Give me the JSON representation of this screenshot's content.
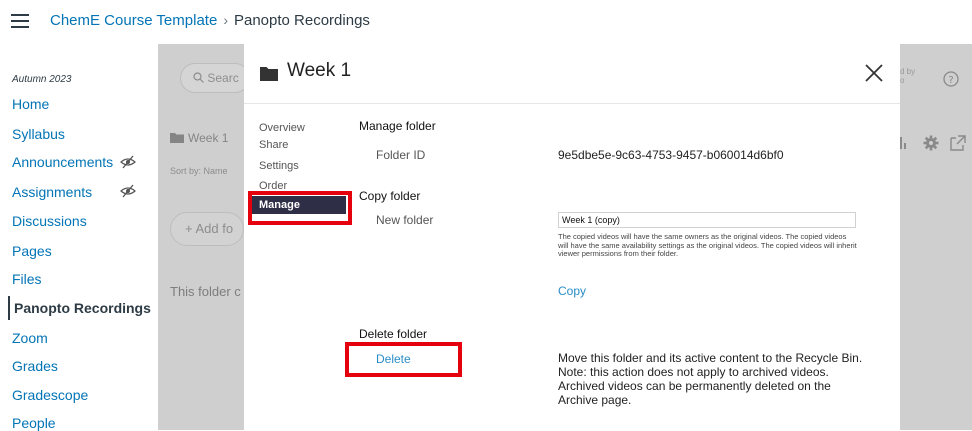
{
  "topbar": {
    "course_name": "ChemE Course Template",
    "separator": "›",
    "current_page": "Panopto Recordings"
  },
  "sidebar": {
    "term": "Autumn 2023",
    "items": [
      {
        "label": "Home"
      },
      {
        "label": "Syllabus"
      },
      {
        "label": "Announcements"
      },
      {
        "label": "Assignments"
      },
      {
        "label": "Discussions"
      },
      {
        "label": "Pages"
      },
      {
        "label": "Files"
      },
      {
        "label": "Panopto Recordings"
      },
      {
        "label": "Zoom"
      },
      {
        "label": "Grades"
      },
      {
        "label": "Gradescope"
      },
      {
        "label": "People"
      }
    ]
  },
  "background": {
    "search_placeholder": "Searc",
    "folder_crumb": "Week 1",
    "sort_by": "Sort by:  Name",
    "add_button": "+  Add fo",
    "empty_text": "This folder c",
    "right_meta_line1": "d by",
    "right_meta_line2": "o"
  },
  "modal": {
    "title": "Week 1",
    "nav": {
      "overview": "Overview",
      "share": "Share",
      "settings": "Settings",
      "order": "Order",
      "manage": "Manage"
    },
    "manage_folder": {
      "heading": "Manage folder",
      "folder_id_label": "Folder ID",
      "folder_id_value": "9e5dbe5e-9c63-4753-9457-b060014d6bf0"
    },
    "copy_folder": {
      "heading": "Copy folder",
      "new_folder_label": "New folder",
      "new_folder_value": "Week 1 (copy)",
      "note": "The copied videos will have the same owners as the original videos. The copied videos will have the same availability settings as the original videos. The copied videos will inherit viewer permissions from their folder.",
      "copy_label": "Copy"
    },
    "delete_folder": {
      "heading": "Delete folder",
      "delete_label": "Delete",
      "note": "Move this folder and its active content to the Recycle Bin. Note: this action does not apply to archived videos. Archived videos can be permanently deleted on the Archive page."
    }
  },
  "colors": {
    "link": "#0374b5",
    "highlight": "#e5000d",
    "nav_active_bg": "#2f2e47",
    "overlay": "#cfcfcf"
  }
}
